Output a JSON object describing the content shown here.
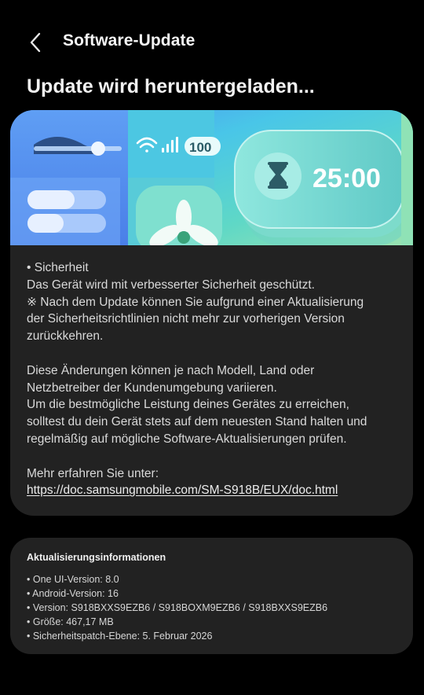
{
  "appbar": {
    "back_icon": "chevron-left-icon",
    "title": "Software-Update"
  },
  "headline": "Update wird heruntergeladen...",
  "banner": {
    "timer_text": "25:00",
    "battery_text": "100",
    "icons": [
      "wifi-icon",
      "signal-icon",
      "hourglass-icon",
      "fan-icon",
      "slider-icon"
    ],
    "colors": {
      "teal": "#4fd3c8",
      "blue": "#5b8ff0",
      "green": "#7ee0a8",
      "dark": "#1e3a44"
    }
  },
  "notes": {
    "line1": "• Sicherheit",
    "line2": "Das Gerät wird mit verbesserter Sicherheit geschützt.",
    "line3": "※ Nach dem Update können Sie aufgrund einer Aktualisierung",
    "line4": "der Sicherheitsrichtlinien nicht mehr zur vorherigen Version",
    "line5": "zurückkehren.",
    "line6": "Diese Änderungen können je nach Modell, Land oder",
    "line7": "Netzbetreiber der Kundenumgebung variieren.",
    "line8": "Um die bestmögliche Leistung deines Gerätes zu erreichen,",
    "line9": "solltest du dein Gerät stets auf dem neuesten Stand halten und",
    "line10": "regelmäßig auf mögliche Software-Aktualisierungen prüfen.",
    "more_label": "Mehr erfahren Sie unter:",
    "link": "https://doc.samsungmobile.com/SM-S918B/EUX/doc.html"
  },
  "update_info": {
    "title": "Aktualisierungsinformationen",
    "items": [
      "• One UI-Version: 8.0",
      "• Android-Version: 16",
      "• Version: S918BXXS9EZB6 / S918BOXM9EZB6 / S918BXXS9EZB6",
      "• Größe: 467,17 MB",
      "• Sicherheitspatch-Ebene: 5. Februar 2026"
    ]
  }
}
